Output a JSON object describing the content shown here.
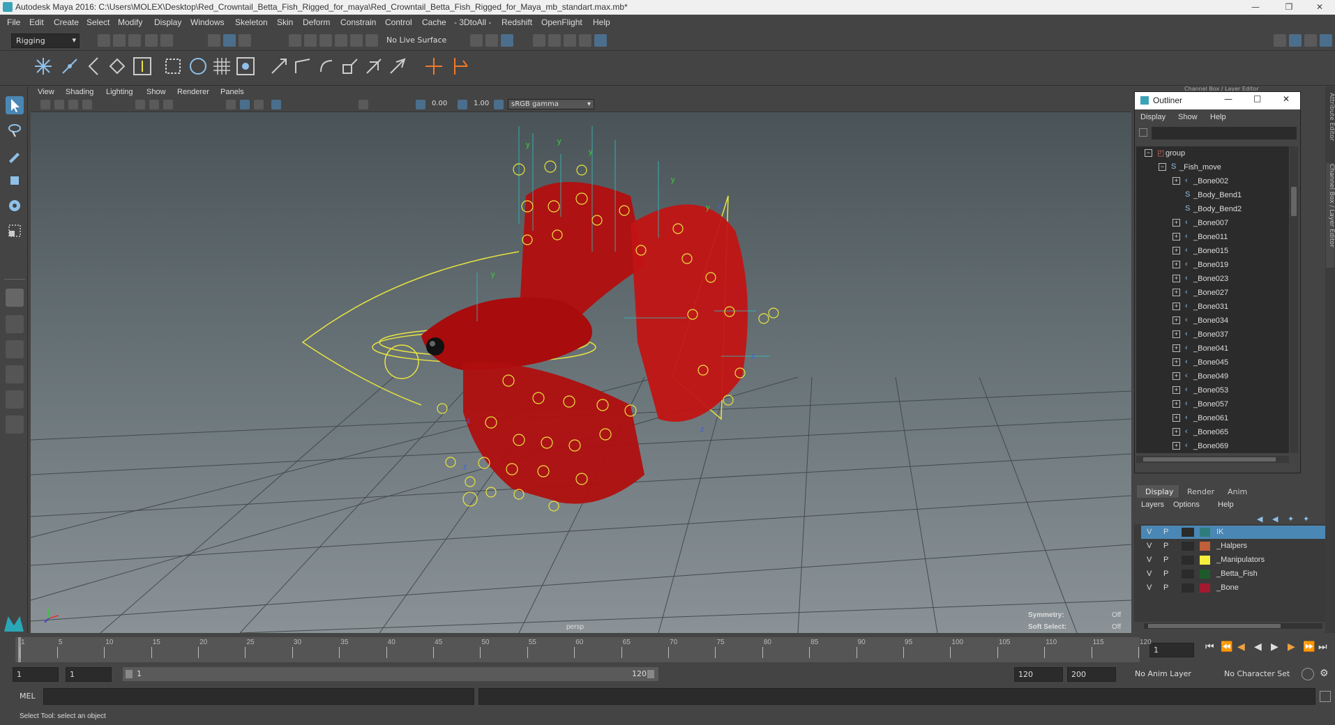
{
  "window": {
    "title": "Autodesk Maya 2016: C:\\Users\\MOLEX\\Desktop\\Red_Crowntail_Betta_Fish_Rigged_for_maya\\Red_Crowntail_Betta_Fish_Rigged_for_Maya_mb_standart.max.mb*"
  },
  "menubar": [
    "File",
    "Edit",
    "Create",
    "Select",
    "Modify",
    "Display",
    "Windows",
    "Skeleton",
    "Skin",
    "Deform",
    "Constrain",
    "Control",
    "Cache",
    "- 3DtoAll -",
    "Redshift",
    "OpenFlight",
    "Help"
  ],
  "statusline": {
    "menuset": "Rigging",
    "live_surface": "No Live Surface"
  },
  "viewport": {
    "menu": [
      "View",
      "Shading",
      "Lighting",
      "Show",
      "Renderer",
      "Panels"
    ],
    "toolbar": {
      "value1": "0.00",
      "value2": "1.00",
      "color_space": "sRGB gamma"
    },
    "camera_label": "persp",
    "symmetry_label": "Symmetry:",
    "symmetry_value": "Off",
    "soft_select_label": "Soft Select:",
    "soft_select_value": "Off"
  },
  "channel_box_strip": {
    "top_label": "Channel Box / Layer Editor",
    "side_labels": [
      "Attribute Editor",
      "Channel Box / Layer Editor"
    ]
  },
  "outliner": {
    "title": "Outliner",
    "menu": [
      "Display",
      "Show",
      "Help"
    ],
    "items": [
      {
        "label": "group",
        "depth": 0,
        "expander": "−",
        "icon": "group-icon"
      },
      {
        "label": "_Fish_move",
        "depth": 1,
        "expander": "−",
        "icon": "curve-icon"
      },
      {
        "label": "_Bone002",
        "depth": 2,
        "expander": "+",
        "icon": "joint-icon"
      },
      {
        "label": "_Body_Bend1",
        "depth": 2,
        "expander": "",
        "icon": "curve-icon"
      },
      {
        "label": "_Body_Bend2",
        "depth": 2,
        "expander": "",
        "icon": "curve-icon"
      },
      {
        "label": "_Bone007",
        "depth": 2,
        "expander": "+",
        "icon": "joint-icon"
      },
      {
        "label": "_Bone011",
        "depth": 2,
        "expander": "+",
        "icon": "joint-icon"
      },
      {
        "label": "_Bone015",
        "depth": 2,
        "expander": "+",
        "icon": "joint-icon"
      },
      {
        "label": "_Bone019",
        "depth": 2,
        "expander": "+",
        "icon": "joint-icon"
      },
      {
        "label": "_Bone023",
        "depth": 2,
        "expander": "+",
        "icon": "joint-icon"
      },
      {
        "label": "_Bone027",
        "depth": 2,
        "expander": "+",
        "icon": "joint-icon"
      },
      {
        "label": "_Bone031",
        "depth": 2,
        "expander": "+",
        "icon": "joint-icon"
      },
      {
        "label": "_Bone034",
        "depth": 2,
        "expander": "+",
        "icon": "joint-icon"
      },
      {
        "label": "_Bone037",
        "depth": 2,
        "expander": "+",
        "icon": "joint-icon"
      },
      {
        "label": "_Bone041",
        "depth": 2,
        "expander": "+",
        "icon": "joint-icon"
      },
      {
        "label": "_Bone045",
        "depth": 2,
        "expander": "+",
        "icon": "joint-icon"
      },
      {
        "label": "_Bone049",
        "depth": 2,
        "expander": "+",
        "icon": "joint-icon"
      },
      {
        "label": "_Bone053",
        "depth": 2,
        "expander": "+",
        "icon": "joint-icon"
      },
      {
        "label": "_Bone057",
        "depth": 2,
        "expander": "+",
        "icon": "joint-icon"
      },
      {
        "label": "_Bone061",
        "depth": 2,
        "expander": "+",
        "icon": "joint-icon"
      },
      {
        "label": "_Bone065",
        "depth": 2,
        "expander": "+",
        "icon": "joint-icon"
      },
      {
        "label": "_Bone069",
        "depth": 2,
        "expander": "+",
        "icon": "joint-icon"
      }
    ]
  },
  "layer_editor": {
    "tabs": [
      "Display",
      "Render",
      "Anim"
    ],
    "active_tab": "Display",
    "menu": [
      "Layers",
      "Options",
      "Help"
    ],
    "layers": [
      {
        "v": "V",
        "p": "P",
        "name": "IK",
        "color": "#2e7d7d",
        "selected": true
      },
      {
        "v": "V",
        "p": "P",
        "name": "_Halpers",
        "color": "#c0603a",
        "selected": false
      },
      {
        "v": "V",
        "p": "P",
        "name": "_Manipulators",
        "color": "#f5f03c",
        "selected": false
      },
      {
        "v": "V",
        "p": "P",
        "name": "_Betta_Fish",
        "color": "#1f5a2a",
        "selected": false
      },
      {
        "v": "V",
        "p": "P",
        "name": "_Bone",
        "color": "#a31a30",
        "selected": false
      }
    ]
  },
  "timeline": {
    "ticks": [
      "1",
      "5",
      "10",
      "15",
      "20",
      "25",
      "30",
      "35",
      "40",
      "45",
      "50",
      "55",
      "60",
      "65",
      "70",
      "75",
      "80",
      "85",
      "90",
      "95",
      "100",
      "105",
      "110",
      "115",
      "120"
    ],
    "current_frame": "1"
  },
  "range": {
    "start": "1",
    "playback_start": "1",
    "slider_start": "1",
    "slider_end": "120",
    "playback_end": "120",
    "end": "200",
    "anim_layer": "No Anim Layer",
    "char_set": "No Character Set"
  },
  "cmdline": {
    "label": "MEL"
  },
  "helpline": {
    "text": "Select Tool: select an object"
  },
  "colors": {
    "fish": "#b80f0f",
    "rig_yellow": "#e9e43f",
    "ik_cyan": "#2ec0c0",
    "selected_blue": "#4b87b4"
  }
}
